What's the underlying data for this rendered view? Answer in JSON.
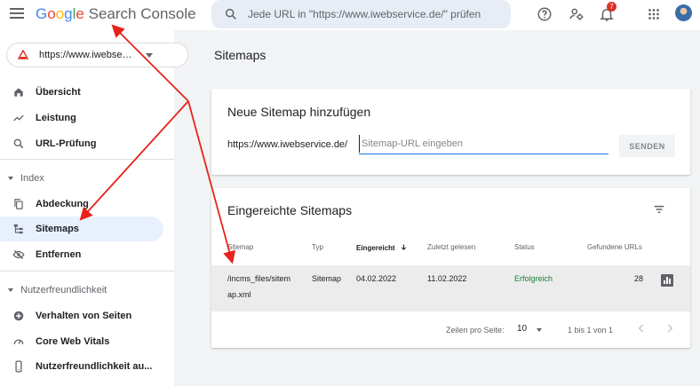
{
  "header": {
    "logo_google_letters": [
      "G",
      "o",
      "o",
      "g",
      "l",
      "e"
    ],
    "logo_google_colors": [
      "#4285f4",
      "#ea4335",
      "#fbbc05",
      "#4285f4",
      "#34a853",
      "#ea4335"
    ],
    "logo_product": "Search Console",
    "search_placeholder": "Jede URL in \"https://www.iwebservice.de/\" prüfen",
    "notification_count": "7",
    "icons": [
      "menu-icon",
      "search-icon",
      "help-icon",
      "manage-users-icon",
      "notifications-icon",
      "apps-grid-icon"
    ]
  },
  "sidebar": {
    "property": "https://www.iwebservice.de/",
    "items_top": [
      {
        "label": "Übersicht",
        "icon": "home-icon"
      },
      {
        "label": "Leistung",
        "icon": "trending-icon"
      },
      {
        "label": "URL-Prüfung",
        "icon": "search-icon"
      }
    ],
    "section_index": "Index",
    "items_index": [
      {
        "label": "Abdeckung",
        "icon": "copy-icon"
      },
      {
        "label": "Sitemaps",
        "icon": "sitemap-icon",
        "active": true
      },
      {
        "label": "Entfernen",
        "icon": "visibility-off-icon"
      }
    ],
    "section_ux": "Nutzerfreundlichkeit",
    "items_ux": [
      {
        "label": "Verhalten von Seiten",
        "icon": "add-circle-icon"
      },
      {
        "label": "Core Web Vitals",
        "icon": "speed-icon"
      },
      {
        "label": "Nutzerfreundlichkeit au...",
        "icon": "phone-icon"
      }
    ]
  },
  "main": {
    "page_title": "Sitemaps",
    "add_card": {
      "title": "Neue Sitemap hinzufügen",
      "url_prefix": "https://www.iwebservice.de/",
      "input_placeholder": "Sitemap-URL eingeben",
      "submit_label": "SENDEN"
    },
    "list_card": {
      "title": "Eingereichte Sitemaps",
      "columns": [
        "Sitemap",
        "Typ",
        "Eingereicht",
        "Zuletzt gelesen",
        "Status",
        "Gefundene URLs"
      ],
      "sorted_column": "Eingereicht",
      "rows": [
        {
          "sitemap_line1": "/incms_files/sitem",
          "sitemap_line2": "ap.xml",
          "type": "Sitemap",
          "submitted": "04.02.2022",
          "last_read": "11.02.2022",
          "status": "Erfolgreich",
          "urls": "28"
        }
      ],
      "pager": {
        "rows_per_page_label": "Zeilen pro Seite:",
        "rows_per_page": "10",
        "range": "1 bis 1 von 1"
      }
    }
  },
  "colors": {
    "accent": "#1a73e8",
    "success": "#188038",
    "annotation": "#e8231c",
    "active_nav": "#e8f0fe"
  }
}
